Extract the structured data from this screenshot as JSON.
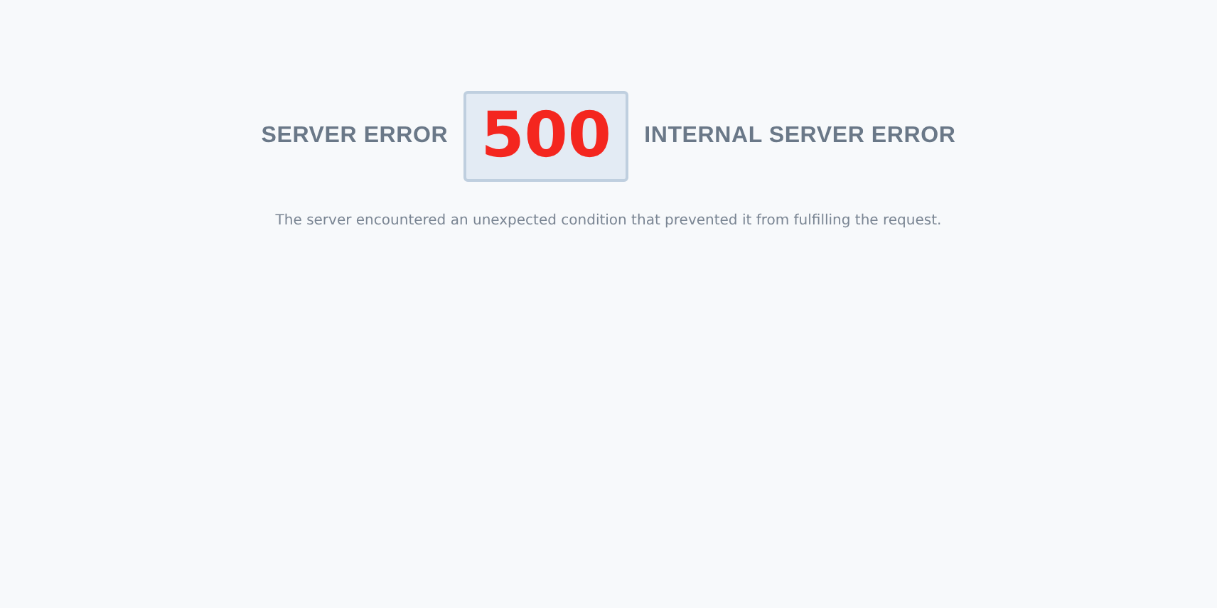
{
  "error": {
    "category": "SERVER ERROR",
    "code": "500",
    "title": "INTERNAL SERVER ERROR"
  },
  "message": "The server encountered an unexpected condition that prevented it from fulfilling the request."
}
